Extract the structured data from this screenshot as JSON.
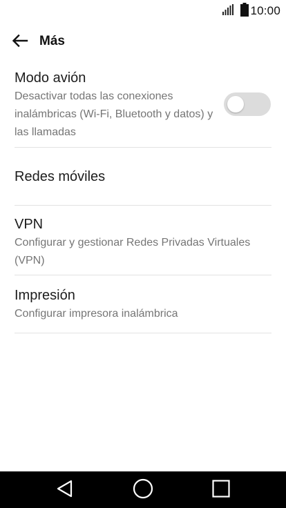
{
  "status_bar": {
    "time": "10:00",
    "icons": [
      "signal-icon",
      "battery-icon"
    ]
  },
  "header": {
    "back_icon": "arrow-left-icon",
    "title": "Más"
  },
  "settings": {
    "airplane": {
      "title": "Modo avión",
      "description": "Desactivar todas las conexiones inalámbricas (Wi-Fi, Bluetooth y datos) y las llamadas",
      "toggle_state": "off"
    },
    "mobile_networks": {
      "title": "Redes móviles"
    },
    "vpn": {
      "title": "VPN",
      "description": "Configurar y gestionar Redes Privadas Virtuales (VPN)"
    },
    "printing": {
      "title": "Impresión",
      "description": "Configurar impresora inalámbrica"
    }
  },
  "nav_bar": {
    "icons": [
      "back-triangle-icon",
      "home-circle-icon",
      "recents-square-icon"
    ]
  },
  "colors": {
    "background": "#ffffff",
    "divider": "#e2e2e2",
    "toggle_track_off": "#dcdcdc",
    "nav_bar": "#000000"
  }
}
